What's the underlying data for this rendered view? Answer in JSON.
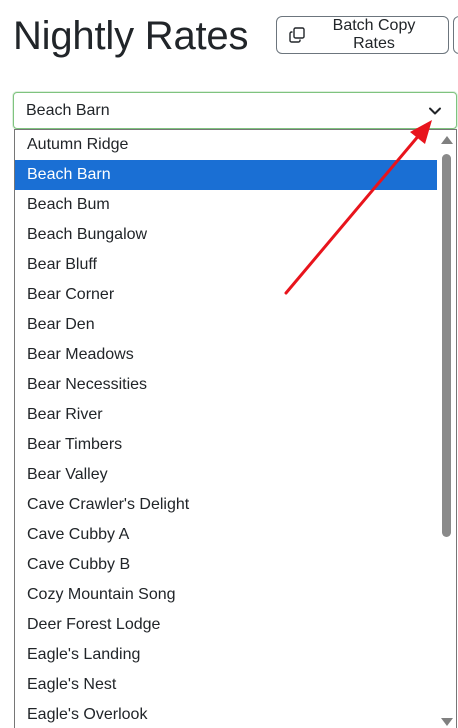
{
  "page": {
    "title": "Nightly Rates"
  },
  "toolbar": {
    "batch_copy_label": "Batch Copy Rates"
  },
  "property_select": {
    "selected_value": "Beach Barn",
    "options": [
      "Autumn Ridge",
      "Beach Barn",
      "Beach Bum",
      "Beach Bungalow",
      "Bear Bluff",
      "Bear Corner",
      "Bear Den",
      "Bear Meadows",
      "Bear Necessities",
      "Bear River",
      "Bear Timbers",
      "Bear Valley",
      "Cave Crawler's Delight",
      "Cave Cubby A",
      "Cave Cubby B",
      "Cozy Mountain Song",
      "Deer Forest Lodge",
      "Eagle's Landing",
      "Eagle's Nest",
      "Eagle's Overlook"
    ],
    "highlighted_index": 1
  },
  "colors": {
    "highlight": "#1a6fd4",
    "focus_border": "#7fc37f",
    "annotation_arrow": "#e8141c"
  },
  "icons": {
    "batch_copy": "copy-icon",
    "select_toggle": "chevron-down-icon",
    "annotation": "red-arrow-annotation"
  }
}
